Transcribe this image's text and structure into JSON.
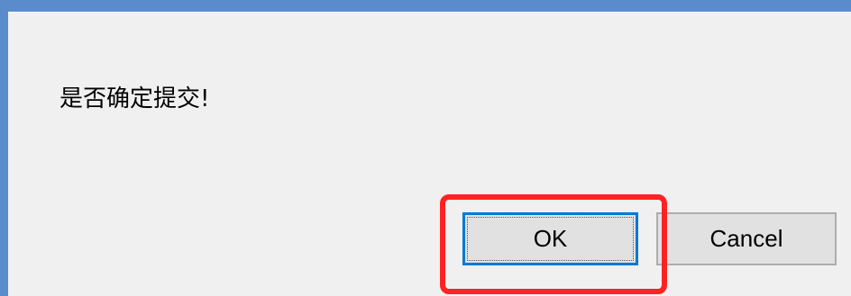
{
  "dialog": {
    "message": "是否确定提交!",
    "buttons": {
      "ok_label": "OK",
      "cancel_label": "Cancel"
    }
  },
  "colors": {
    "window_border": "#5a8ccb",
    "dialog_background": "#f0f0f0",
    "button_background": "#e1e1e1",
    "focus_border": "#0078d7",
    "highlight": "#ff2222"
  }
}
